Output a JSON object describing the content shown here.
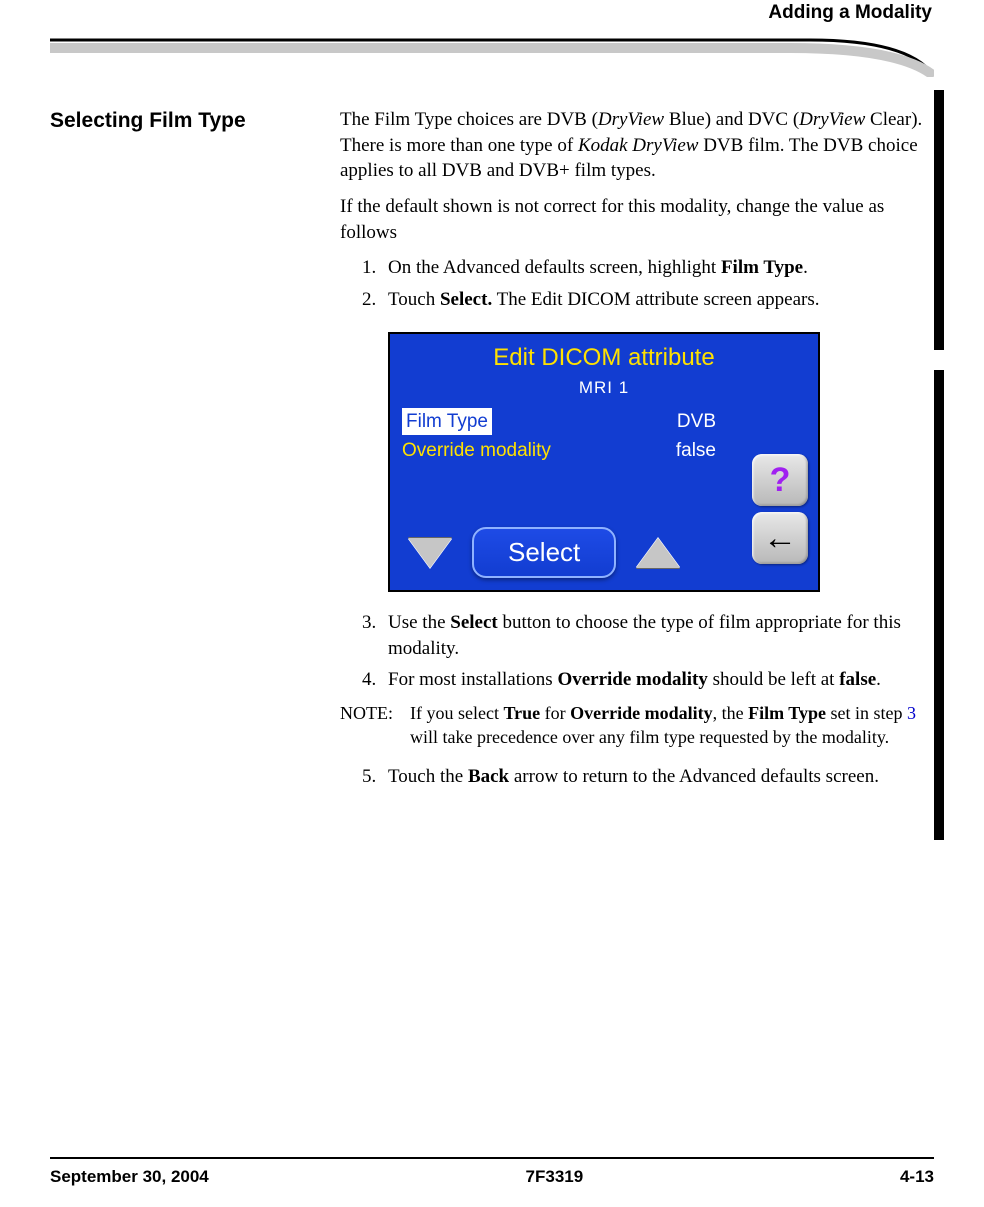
{
  "header": {
    "section_title": "Adding a Modality"
  },
  "side_heading": "Selecting Film Type",
  "paragraphs": {
    "p1a": "The Film Type choices are DVB (",
    "p1b": "DryView",
    "p1c": " Blue) and DVC (",
    "p1d": "DryView",
    "p1e": " Clear). There is more than one type of ",
    "p1f": "Kodak DryView",
    "p1g": " DVB film. The DVB choice applies to all DVB and DVB+ film types.",
    "p2": "If the default shown is not correct for this modality, change the value as follows"
  },
  "steps": {
    "s1_num": "1.",
    "s1a": "On the Advanced defaults screen, highlight ",
    "s1b": "Film Type",
    "s1c": ".",
    "s2_num": "2.",
    "s2a": "Touch ",
    "s2b": "Select.",
    "s2c": " The Edit DICOM attribute screen appears.",
    "s3_num": "3.",
    "s3a": "Use the ",
    "s3b": "Select",
    "s3c": " button to choose the type of film appropriate for this modality.",
    "s4_num": "4.",
    "s4a": "For most installations ",
    "s4b": "Override modality",
    "s4c": " should be left at ",
    "s4d": "false",
    "s4e": ".",
    "s5_num": "5.",
    "s5a": "Touch the ",
    "s5b": "Back",
    "s5c": " arrow to return to the Advanced defaults screen."
  },
  "note": {
    "label": "NOTE:",
    "a": "If you select ",
    "b": "True",
    "c": " for ",
    "d": "Override modality",
    "e": ", the ",
    "f": "Film Type",
    "g": " set in step ",
    "link": "3",
    "h": " will take precedence over any film type requested by the modality."
  },
  "lcd": {
    "title": "Edit DICOM attribute",
    "subtitle": "MRI 1",
    "row1_label": "Film Type",
    "row1_value": "DVB",
    "row2_label": "Override modality",
    "row2_value": "false",
    "select": "Select",
    "help": "?",
    "back": "←"
  },
  "footer": {
    "date": "September 30, 2004",
    "docnum": "7F3319",
    "pagenum": "4-13"
  }
}
